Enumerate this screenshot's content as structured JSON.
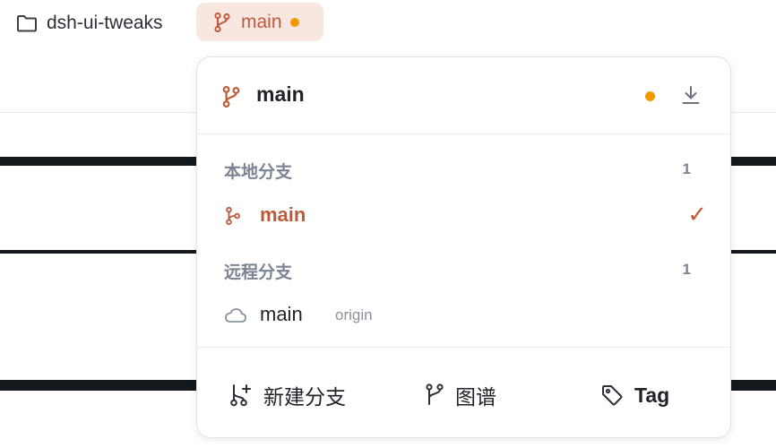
{
  "topbar": {
    "folder": {
      "name": "dsh-ui-tweaks",
      "icon": "folder-icon"
    },
    "branch_chip": {
      "name": "main",
      "icon": "git-branch-icon",
      "status_color": "#f09a00"
    }
  },
  "dropdown": {
    "header": {
      "branch": "main",
      "status_color": "#f09a00",
      "download_icon": "download-icon"
    },
    "local": {
      "label": "本地分支",
      "count": "1",
      "items": [
        {
          "name": "main",
          "selected": true,
          "check": "✓"
        }
      ]
    },
    "remote": {
      "label": "远程分支",
      "count": "1",
      "items": [
        {
          "name": "main",
          "remote": "origin",
          "icon": "cloud-icon"
        }
      ]
    },
    "footer": {
      "new_branch": "新建分支",
      "graph": "图谱",
      "tag": "Tag"
    }
  },
  "colors": {
    "accent": "#c0583a",
    "chip_bg": "#f8e7e1",
    "status_dot": "#f09a00"
  }
}
